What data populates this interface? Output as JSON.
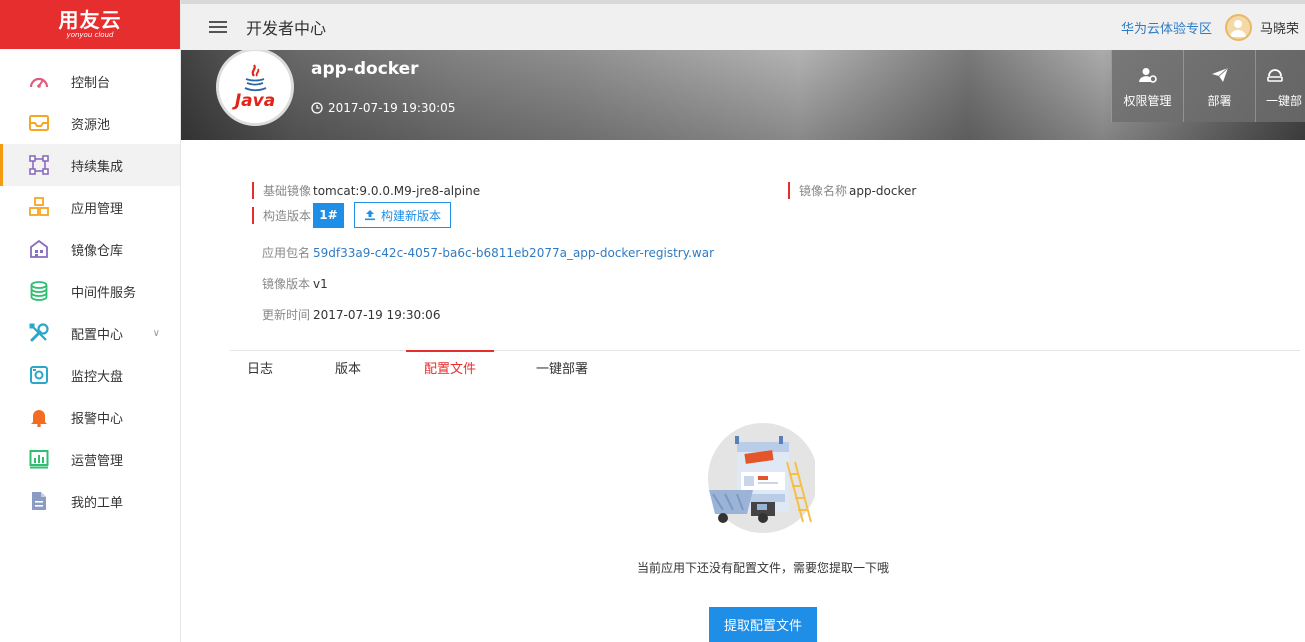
{
  "brand": {
    "name": "用友云",
    "sub": "yonyou cloud",
    "color": "#e62e2e"
  },
  "header": {
    "title": "开发者中心",
    "huawei_link": "华为云体验专区",
    "username": "马晓荣"
  },
  "sidebar": {
    "items": [
      {
        "label": "控制台",
        "icon": "dashboard-icon",
        "color": "#e05a7a"
      },
      {
        "label": "资源池",
        "icon": "inbox-icon",
        "color": "#f5a623"
      },
      {
        "label": "持续集成",
        "icon": "integration-icon",
        "color": "#8a6bbf",
        "active": true
      },
      {
        "label": "应用管理",
        "icon": "cubes-icon",
        "color": "#f5a623"
      },
      {
        "label": "镜像仓库",
        "icon": "warehouse-icon",
        "color": "#8a6bbf"
      },
      {
        "label": "中间件服务",
        "icon": "database-icon",
        "color": "#2fbf71"
      },
      {
        "label": "配置中心",
        "icon": "tools-icon",
        "color": "#2aa7c9",
        "has_caret": true
      },
      {
        "label": "监控大盘",
        "icon": "monitor-icon",
        "color": "#2aa7c9"
      },
      {
        "label": "报警中心",
        "icon": "bell-icon",
        "color": "#f36c21"
      },
      {
        "label": "运营管理",
        "icon": "chart-icon",
        "color": "#2fbf71"
      },
      {
        "label": "我的工单",
        "icon": "document-icon",
        "color": "#8a9bc4"
      }
    ]
  },
  "app": {
    "logo_text": "Java",
    "name": "app-docker",
    "created_at": "2017-07-19 19:30:05",
    "actions": [
      {
        "label": "权限管理",
        "icon": "user-settings-icon"
      },
      {
        "label": "部署",
        "icon": "paper-plane-icon"
      },
      {
        "label": "一键部",
        "icon": "cloud-deploy-icon"
      }
    ]
  },
  "details": {
    "base_image": {
      "label": "基础镜像",
      "value": "tomcat:9.0.0.M9-jre8-alpine"
    },
    "image_name": {
      "label": "镜像名称",
      "value": "app-docker"
    },
    "build_version": {
      "label": "构造版本",
      "badge": "1#",
      "button": "构建新版本"
    },
    "package": {
      "label": "应用包名",
      "value": "59df33a9-c42c-4057-ba6c-b6811eb2077a_app-docker-registry.war"
    },
    "image_version": {
      "label": "镜像版本",
      "value": "v1"
    },
    "updated_at": {
      "label": "更新时间",
      "value": "2017-07-19 19:30:06"
    }
  },
  "tabs": [
    {
      "label": "日志"
    },
    {
      "label": "版本"
    },
    {
      "label": "配置文件",
      "active": true
    },
    {
      "label": "一键部署"
    }
  ],
  "empty_state": {
    "message": "当前应用下还没有配置文件，需要您提取一下哦",
    "button": "提取配置文件"
  }
}
